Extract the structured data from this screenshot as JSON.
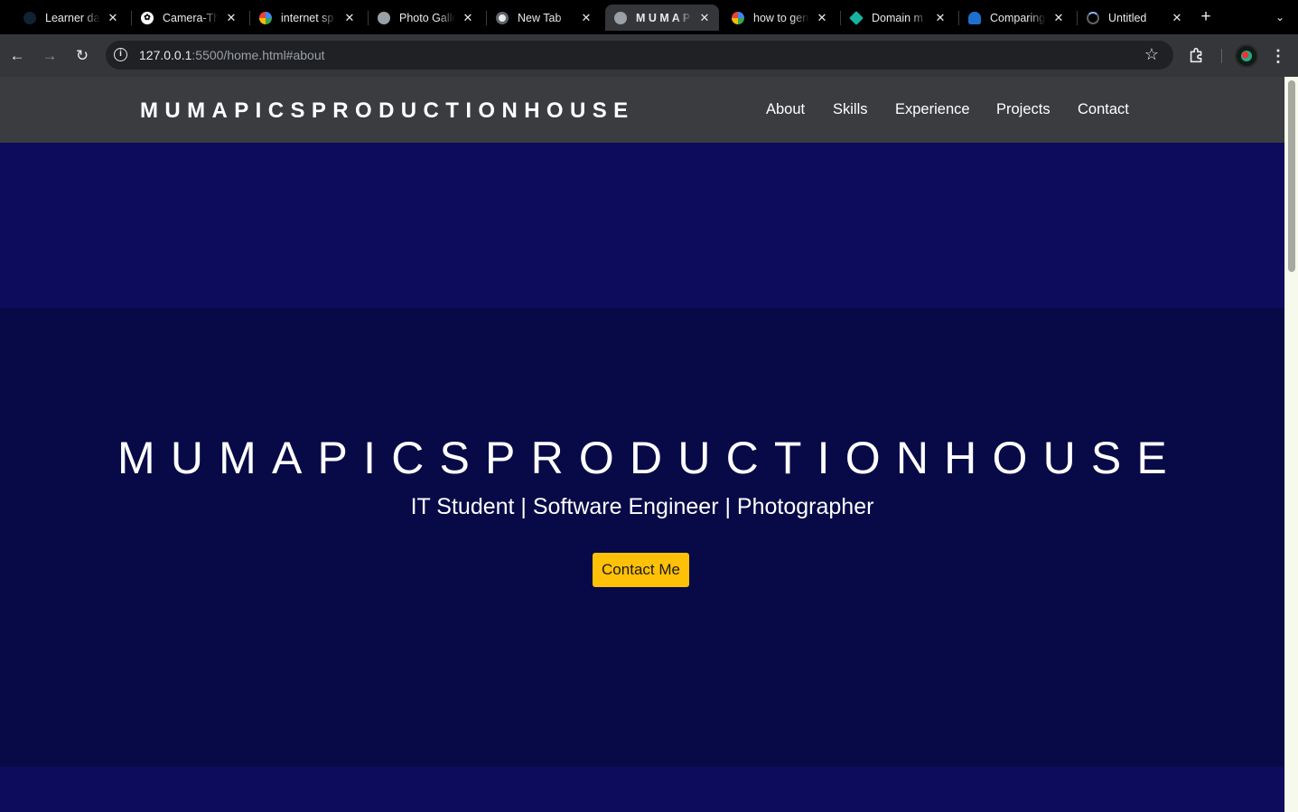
{
  "browser": {
    "tabs": [
      {
        "title": "Learner da",
        "active": false
      },
      {
        "title": "Camera-Th",
        "active": false
      },
      {
        "title": "internet sp",
        "active": false
      },
      {
        "title": "Photo Galle",
        "active": false
      },
      {
        "title": "New Tab",
        "active": false
      },
      {
        "title": "M U M A P",
        "active": true
      },
      {
        "title": "how to gen",
        "active": false
      },
      {
        "title": "Domain m",
        "active": false
      },
      {
        "title": "Comparing",
        "active": false
      },
      {
        "title": "Untitled",
        "active": false
      }
    ],
    "url_host": "127.0.0.1",
    "url_rest": ":5500/home.html#about"
  },
  "site": {
    "brand": "MUMAPICSPRODUCTIONHOUSE",
    "nav": [
      "About",
      "Skills",
      "Experience",
      "Projects",
      "Contact"
    ]
  },
  "hero": {
    "title": "MUMAPICSPRODUCTIONHOUSE",
    "subtitle": "IT Student | Software Engineer | Photographer",
    "cta_label": "Contact Me"
  },
  "colors": {
    "nav_bg": "#3a3c40",
    "section_bg": "#0d0b5c",
    "hero_bg": "#080a47",
    "cta_bg": "#ffc107"
  }
}
